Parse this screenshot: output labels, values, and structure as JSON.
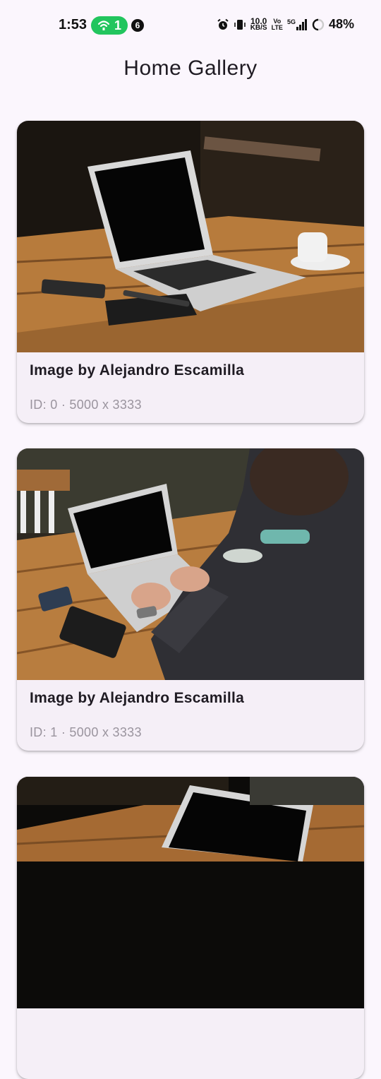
{
  "status_bar": {
    "time": "1:53",
    "hotspot_count": "1",
    "notification_count": "6",
    "speed_value": "10.0",
    "speed_unit": "KB/S",
    "volte_top": "Vo",
    "volte_bottom": "LTE",
    "network": "5G",
    "battery": "48%"
  },
  "header": {
    "title": "Home Gallery"
  },
  "gallery": {
    "items": [
      {
        "title": "Image by Alejandro Escamilla",
        "meta": "ID: 0 · 5000 x 3333"
      },
      {
        "title": "Image by Alejandro Escamilla",
        "meta": "ID: 1 · 5000 x 3333"
      },
      {
        "title": "",
        "meta": ""
      }
    ]
  },
  "colors": {
    "background": "#fbf6fd",
    "card": "#f5eff7",
    "hotspot": "#22c55e",
    "meta_text": "#9a949e"
  }
}
